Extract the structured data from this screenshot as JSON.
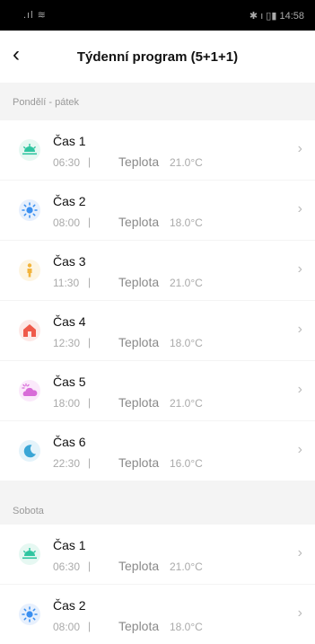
{
  "status_bar": {
    "signal": ".ıl ≋",
    "right": "✱ ı ▯▮ 14:58"
  },
  "header": {
    "title": "Týdenní program  (5+1+1)"
  },
  "sections": [
    {
      "label": "Pondělí - pátek"
    },
    {
      "label": "Sobota"
    }
  ],
  "rows": [
    {
      "name": "Čas 1",
      "time": "06:30",
      "sep": "|",
      "temp_label": "Teplota",
      "temp": "21.0°C",
      "icon": "sunrise-icon",
      "icon_color": "#2fc5a0",
      "bg": "#e6f8f2"
    },
    {
      "name": "Čas 2",
      "time": "08:00",
      "sep": "|",
      "temp_label": "Teplota",
      "temp": "18.0°C",
      "icon": "sun-icon",
      "icon_color": "#3a8ff0",
      "bg": "#e7f0fd"
    },
    {
      "name": "Čas 3",
      "time": "11:30",
      "sep": "|",
      "temp_label": "Teplota",
      "temp": "21.0°C",
      "icon": "person-icon",
      "icon_color": "#f2b43c",
      "bg": "#fdf5e2"
    },
    {
      "name": "Čas 4",
      "time": "12:30",
      "sep": "|",
      "temp_label": "Teplota",
      "temp": "18.0°C",
      "icon": "home-icon",
      "icon_color": "#ef5a4a",
      "bg": "#fde9e7"
    },
    {
      "name": "Čas 5",
      "time": "18:00",
      "sep": "|",
      "temp_label": "Teplota",
      "temp": "21.0°C",
      "icon": "sunset-cloud-icon",
      "icon_color": "#d86bd8",
      "bg": "#fbe9fb"
    },
    {
      "name": "Čas 6",
      "time": "22:30",
      "sep": "|",
      "temp_label": "Teplota",
      "temp": "16.0°C",
      "icon": "moon-icon",
      "icon_color": "#3aa6d6",
      "bg": "#e4f3fa"
    },
    {
      "name": "Čas 1",
      "time": "06:30",
      "sep": "|",
      "temp_label": "Teplota",
      "temp": "21.0°C",
      "icon": "sunrise-icon",
      "icon_color": "#2fc5a0",
      "bg": "#e6f8f2"
    },
    {
      "name": "Čas 2",
      "time": "08:00",
      "sep": "|",
      "temp_label": "Teplota",
      "temp": "18.0°C",
      "icon": "sun-icon",
      "icon_color": "#3a8ff0",
      "bg": "#e7f0fd"
    }
  ],
  "chevron": "›",
  "back": "‹"
}
